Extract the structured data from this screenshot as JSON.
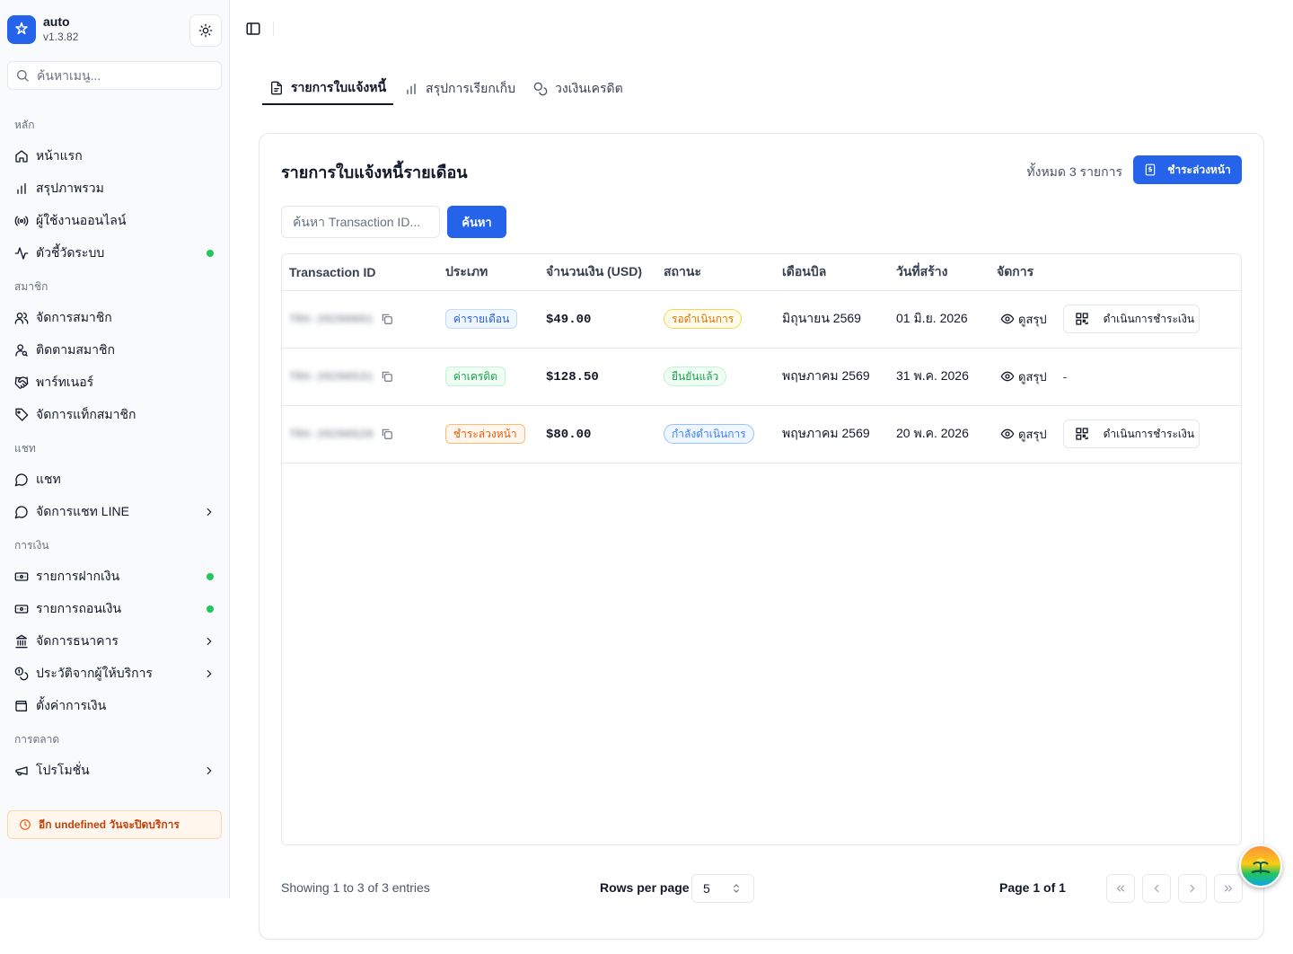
{
  "brand": {
    "name": "auto",
    "version": "v1.3.82"
  },
  "sidebar": {
    "search_placeholder": "ค้นหาเมนู...",
    "groups": [
      {
        "label": "หลัก",
        "items": [
          {
            "label": "หน้าแรก",
            "icon": "home-icon"
          },
          {
            "label": "สรุปภาพรวม",
            "icon": "bar-chart-icon"
          },
          {
            "label": "ผู้ใช้งานออนไลน์",
            "icon": "radio-icon"
          },
          {
            "label": "ตัวชี้วัดระบบ",
            "icon": "activity-icon",
            "dot": true
          }
        ]
      },
      {
        "label": "สมาชิก",
        "items": [
          {
            "label": "จัดการสมาชิก",
            "icon": "users-icon"
          },
          {
            "label": "ติดตามสมาชิก",
            "icon": "user-search-icon"
          },
          {
            "label": "พาร์ทเนอร์",
            "icon": "handshake-icon"
          },
          {
            "label": "จัดการแท็กสมาชิก",
            "icon": "tag-icon"
          }
        ]
      },
      {
        "label": "แชท",
        "items": [
          {
            "label": "แชท",
            "icon": "chat-icon"
          },
          {
            "label": "จัดการแชท LINE",
            "icon": "chat-icon",
            "chevron": true
          }
        ]
      },
      {
        "label": "การเงิน",
        "items": [
          {
            "label": "รายการฝากเงิน",
            "icon": "deposit-icon",
            "dot": true
          },
          {
            "label": "รายการถอนเงิน",
            "icon": "withdraw-icon",
            "dot": true
          },
          {
            "label": "จัดการธนาคาร",
            "icon": "bank-icon",
            "chevron": true
          },
          {
            "label": "ประวัติจากผู้ให้บริการ",
            "icon": "coins-icon",
            "chevron": true
          },
          {
            "label": "ตั้งค่าการเงิน",
            "icon": "wallet-icon"
          }
        ]
      },
      {
        "label": "การตลาด",
        "items": [
          {
            "label": "โปรโมชั่น",
            "icon": "megaphone-icon",
            "chevron": true
          }
        ]
      }
    ],
    "expiry_notice": "อีก undefined วันจะปิดบริการ"
  },
  "tabs": [
    {
      "label": "รายการใบแจ้งหนี้",
      "icon": "file-icon",
      "active": true
    },
    {
      "label": "สรุปการเรียกเก็บ",
      "icon": "bar-chart-icon",
      "active": false
    },
    {
      "label": "วงเงินเครดิต",
      "icon": "coins-icon",
      "active": false
    }
  ],
  "card": {
    "title": "รายการใบแจ้งหนี้รายเดือน",
    "total": "ทั้งหมด 3 รายการ",
    "prepay_label": "ชำระล่วงหน้า",
    "search_placeholder": "ค้นหา Transaction ID...",
    "search_button": "ค้นหา"
  },
  "table": {
    "headers": [
      "Transaction ID",
      "ประเภท",
      "จำนวนเงิน (USD)",
      "สถานะ",
      "เดือนบิล",
      "วันที่สร้าง",
      "จัดการ"
    ],
    "rows": [
      {
        "txid": "TRX-20260601",
        "type": "ค่ารายเดือน",
        "type_color": "blue",
        "amount": "$49.00",
        "status": "รอดำเนินการ",
        "status_color": "amber",
        "bill_month": "มิถุนายน 2569",
        "created": "01 มิ.ย. 2026",
        "view": "ดูสรุป",
        "pay": "ดำเนินการชำระเงิน"
      },
      {
        "txid": "TRX-20260531",
        "type": "ค่าเครดิต",
        "type_color": "green",
        "amount": "$128.50",
        "status": "ยืนยันแล้ว",
        "status_color": "green",
        "bill_month": "พฤษภาคม 2569",
        "created": "31 พ.ค. 2026",
        "view": "ดูสรุป",
        "pay": "-"
      },
      {
        "txid": "TRX-20260520",
        "type": "ชำระล่วงหน้า",
        "type_color": "orange",
        "amount": "$80.00",
        "status": "กำลังดำเนินการ",
        "status_color": "sky",
        "bill_month": "พฤษภาคม 2569",
        "created": "20 พ.ค. 2026",
        "view": "ดูสรุป",
        "pay": "ดำเนินการชำระเงิน"
      }
    ]
  },
  "footer": {
    "showing": "Showing 1 to 3 of 3 entries",
    "rows_per_page_label": "Rows per page",
    "rows_per_page_value": "5",
    "page_info": "Page 1 of 1"
  },
  "colors": {
    "primary": "#2563eb",
    "online_dot": "#22c55e"
  }
}
